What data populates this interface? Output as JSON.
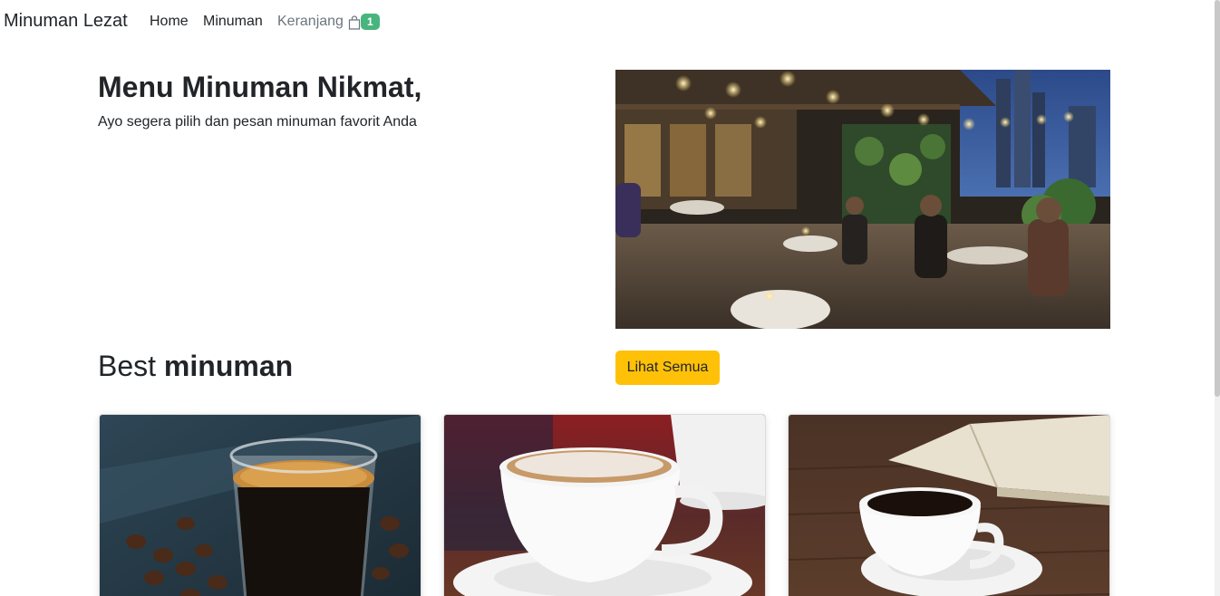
{
  "navbar": {
    "brand": "Minuman Lezat",
    "links": {
      "home": "Home",
      "minuman": "Minuman",
      "keranjang": "Keranjang"
    },
    "cart_count": "1",
    "cart_icon": "shopping-bag-icon",
    "badge_color": "#48b47e"
  },
  "hero": {
    "title": "Menu Minuman Nikmat,",
    "subtitle": "Ayo segera pilih dan pesan minuman favorit Anda"
  },
  "section": {
    "title_light": "Best ",
    "title_bold": "minuman",
    "view_all_label": "Lihat Semua",
    "button_color": "#ffc107"
  },
  "products": [
    {
      "image": "espresso-glass-with-coffee-beans"
    },
    {
      "image": "cappuccino-white-cup"
    },
    {
      "image": "black-coffee-cup-with-open-book"
    }
  ]
}
